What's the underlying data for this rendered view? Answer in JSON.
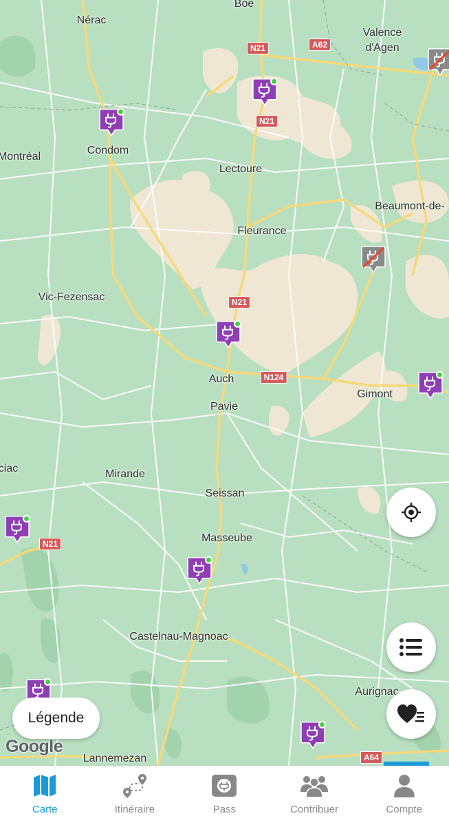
{
  "map": {
    "places": [
      {
        "name": "Boe"
      },
      {
        "name": "Nérac"
      },
      {
        "name": "Valence"
      },
      {
        "name": "d'Agen"
      },
      {
        "name": "Condom"
      },
      {
        "name": "Montréal"
      },
      {
        "name": "Lectoure"
      },
      {
        "name": "Beaumont-de-"
      },
      {
        "name": "Fleurance"
      },
      {
        "name": "Vic-Fezensac"
      },
      {
        "name": "Auch"
      },
      {
        "name": "Gimont"
      },
      {
        "name": "Pavie"
      },
      {
        "name": "ciac"
      },
      {
        "name": "Mirande"
      },
      {
        "name": "Seissan"
      },
      {
        "name": "Masseube"
      },
      {
        "name": "Castelnau-Magnoac"
      },
      {
        "name": "Aurignac"
      },
      {
        "name": "Lannemezan"
      }
    ],
    "road_shields": [
      "N21",
      "A62",
      "N21",
      "N21",
      "N124",
      "N21",
      "A64"
    ],
    "markers": [
      {
        "status": "available"
      },
      {
        "status": "available"
      },
      {
        "status": "available"
      },
      {
        "status": "available"
      },
      {
        "status": "available"
      },
      {
        "status": "available"
      },
      {
        "status": "available"
      },
      {
        "status": "available"
      },
      {
        "status": "out-of-service"
      },
      {
        "status": "out-of-service"
      }
    ],
    "attribution": "Google"
  },
  "buttons": {
    "legend_label": "Légende",
    "locate_icon": "crosshair-icon",
    "list_icon": "list-icon",
    "favorites_icon": "heart-list-icon"
  },
  "colors": {
    "accent": "#1a9bd8",
    "marker_purple": "#8e3fb5",
    "marker_available_dot": "#43d043",
    "marker_disabled": "#8a8a8a",
    "map_green": "#b9dfc1",
    "map_urban": "#efe7d3"
  },
  "tabbar": {
    "tabs": [
      {
        "label": "Carte",
        "icon": "map-icon",
        "active": true
      },
      {
        "label": "Itinéraire",
        "icon": "route-icon",
        "active": false
      },
      {
        "label": "Pass",
        "icon": "charging-card-icon",
        "active": false
      },
      {
        "label": "Contribuer",
        "icon": "people-icon",
        "active": false
      },
      {
        "label": "Compte",
        "icon": "person-icon",
        "active": false
      }
    ]
  }
}
